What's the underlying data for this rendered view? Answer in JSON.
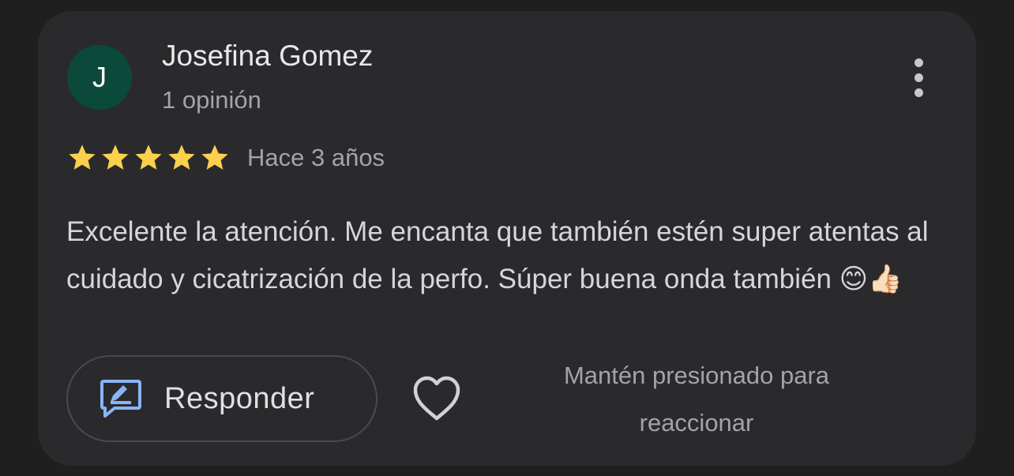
{
  "review": {
    "author": {
      "initial": "J",
      "name": "Josefina Gomez",
      "meta": "1 opinión",
      "avatar_color": "#0b4a3b"
    },
    "rating": 5,
    "rating_max": 5,
    "date": "Hace 3 años",
    "text": "Excelente la atención. Me encanta que también estén super atentas al cuidado y cicatrización de la perfo. Súper buena onda también 😊👍🏻",
    "star_color": "#fbd04d"
  },
  "actions": {
    "reply_label": "Responder",
    "reply_icon": "reply-icon",
    "like_icon": "heart-outline-icon",
    "more_icon": "more-vert-icon",
    "react_hint": "Mantén presionado para reaccionar"
  },
  "colors": {
    "background": "#1f1f20",
    "card": "#2a2a2c",
    "reply_accent": "#8ab4f8"
  }
}
